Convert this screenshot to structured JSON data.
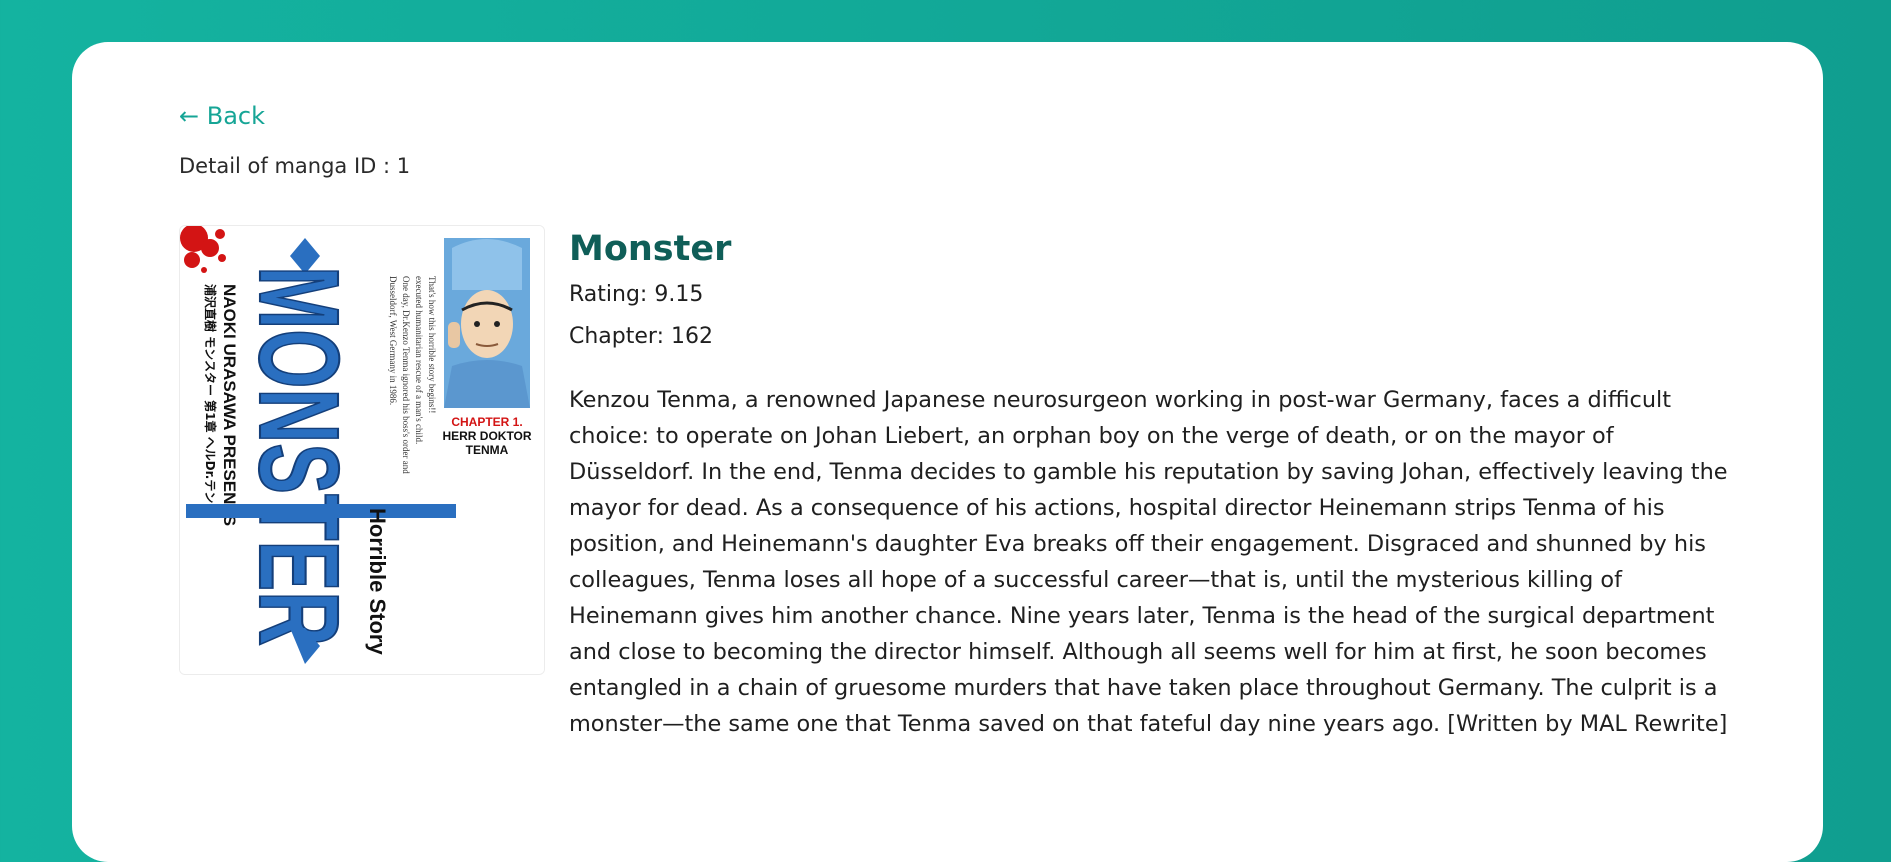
{
  "nav": {
    "back_label": "← Back"
  },
  "detail_label": "Detail of manga ID : 1",
  "manga": {
    "title": "Monster",
    "rating_text": "Rating: 9.15",
    "chapter_text": "Chapter: 162",
    "description": "Kenzou Tenma, a renowned Japanese neurosurgeon working in post-war Germany, faces a difficult choice: to operate on Johan Liebert, an orphan boy on the verge of death, or on the mayor of Düsseldorf. In the end, Tenma decides to gamble his reputation by saving Johan, effectively leaving the mayor for dead. As a consequence of his actions, hospital director Heinemann strips Tenma of his position, and Heinemann's daughter Eva breaks off their engagement. Disgraced and shunned by his colleagues, Tenma loses all hope of a successful career—that is, until the mysterious killing of Heinemann gives him another chance. Nine years later, Tenma is the head of the surgical department and close to becoming the director himself. Although all seems well for him at first, he soon becomes entangled in a chain of gruesome murders that have taken place throughout Germany. The culprit is a monster—the same one that Tenma saved on that fateful day nine years ago. [Written by MAL Rewrite]",
    "cover": {
      "logo_text": "MONSTER",
      "author_line": "NAOKI URASAWA PRESENTS",
      "japanese_line": "浦沢直樹 モンスター 第1章 ヘルDr.テンマ",
      "subtitle": "Horrible Story",
      "blurb": "Dusseldorf, West Germany in 1986. One day, Dr.Kenzo Tenma ignored his boss's order and executed humanitarian rescue of a man's child. That's how this horrible story begins!!",
      "chapter_label": "CHAPTER 1.",
      "chapter_title_1": "HERR DOKTOR",
      "chapter_title_2": "TENMA"
    }
  },
  "colors": {
    "background_start": "#14b3a0",
    "background_end": "#109e8f",
    "accent": "#16a596",
    "title": "#0f5e58",
    "logo_blue": "#2a6fc0",
    "blood_red": "#d31414"
  }
}
